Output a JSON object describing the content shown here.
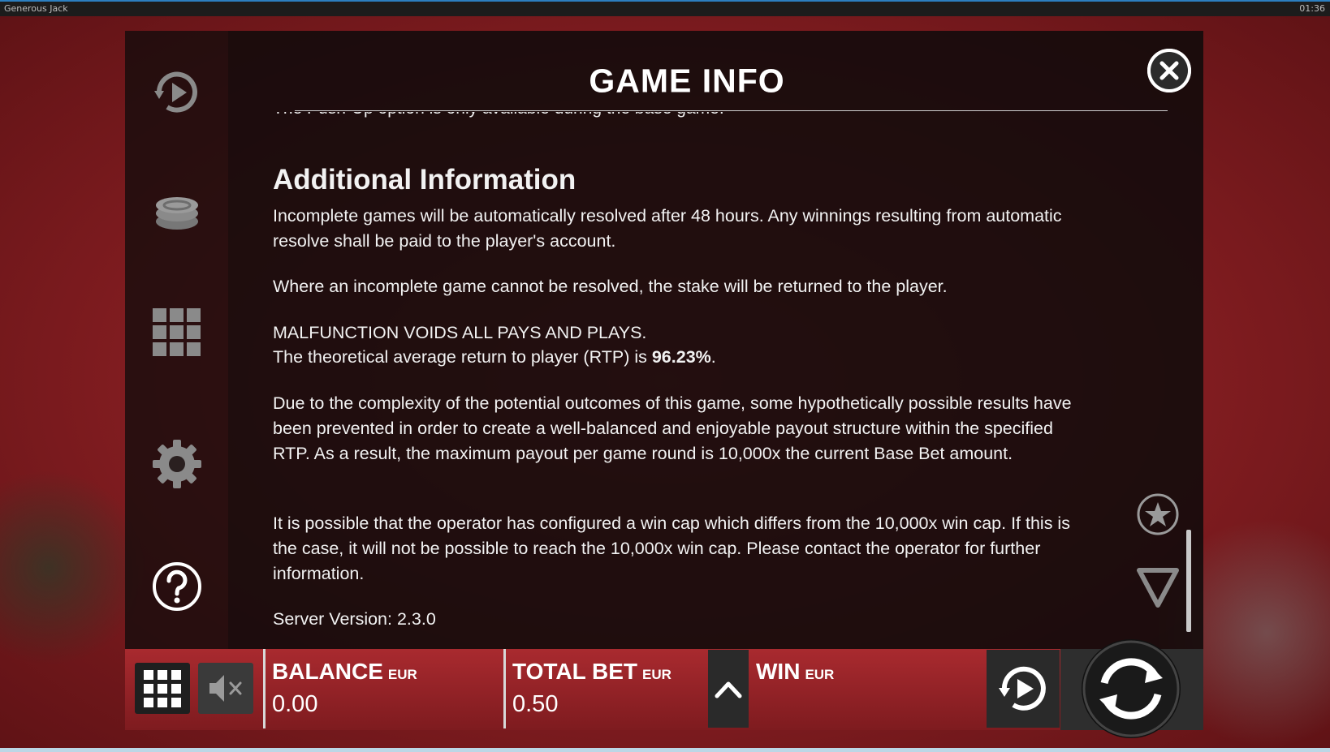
{
  "window": {
    "app_title": "Generous Jack",
    "clock": "01:36"
  },
  "sidebar": {
    "items": [
      {
        "name": "autoplay",
        "icon": "autoplay-icon"
      },
      {
        "name": "bet",
        "icon": "coin-stack-icon"
      },
      {
        "name": "paytable",
        "icon": "grid-icon"
      },
      {
        "name": "settings",
        "icon": "gear-icon"
      },
      {
        "name": "help",
        "icon": "help-icon"
      }
    ]
  },
  "panel": {
    "title": "GAME INFO",
    "cut_line": "The Push-Up option is only available during the base game.",
    "heading": "Additional Information",
    "paragraphs": {
      "p1": "Incomplete games will be automatically resolved after 48 hours. Any winnings resulting from automatic resolve shall be paid to the player's account.",
      "p2": "Where an incomplete game cannot be resolved, the stake will be returned to the player.",
      "p3": "MALFUNCTION VOIDS ALL PAYS AND PLAYS.",
      "p4_prefix": "The theoretical average return to player (RTP) is ",
      "p4_value": "96.23%",
      "p4_suffix": ".",
      "p5": "Due to the complexity of the potential outcomes of this game, some hypothetically possible results have been prevented in order to create a well-balanced and enjoyable payout structure within the specified RTP. As a result, the maximum payout per game round is 10,000x the current Base Bet amount.",
      "p6": "It is possible that the operator has configured a win cap which differs from the 10,000x win cap. If this is the case, it will not be possible to reach the 10,000x win cap. Please contact the operator for further information.",
      "server_version": "Server Version: 2.3.0"
    }
  },
  "bottom_bar": {
    "balance_label": "BALANCE",
    "balance_currency": "EUR",
    "balance_value": "0.00",
    "total_bet_label": "TOTAL BET",
    "total_bet_currency": "EUR",
    "total_bet_value": "0.50",
    "win_label": "WIN",
    "win_currency": "EUR"
  }
}
